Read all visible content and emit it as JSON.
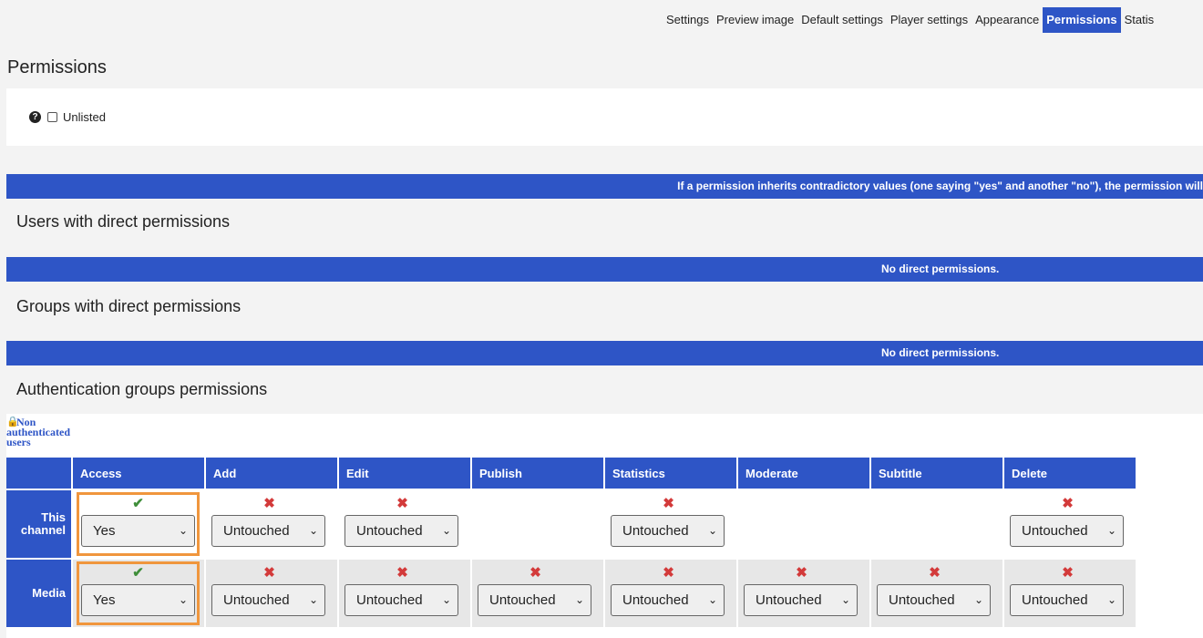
{
  "tabs": [
    {
      "label": "Settings",
      "active": false
    },
    {
      "label": "Preview image",
      "active": false
    },
    {
      "label": "Default settings",
      "active": false
    },
    {
      "label": "Player settings",
      "active": false
    },
    {
      "label": "Appearance",
      "active": false
    },
    {
      "label": "Permissions",
      "active": true
    },
    {
      "label": "Statis",
      "active": false
    }
  ],
  "page_title": "Permissions",
  "unlisted": {
    "label": "Unlisted",
    "checked": false,
    "help_icon": "question-circle-icon"
  },
  "info_bar": "If a permission inherits contradictory values (one saying \"yes\" and another \"no\"), the permission will",
  "users_section": {
    "title": "Users with direct permissions",
    "empty": "No direct permissions."
  },
  "groups_section": {
    "title": "Groups with direct permissions",
    "empty": "No direct permissions."
  },
  "auth_section": {
    "title": "Authentication groups permissions",
    "group_link_line1": "Non",
    "group_link_line2": "authenticated",
    "group_link_line3": "users",
    "lock_icon": "lock-icon"
  },
  "table": {
    "columns": [
      "Access",
      "Add",
      "Edit",
      "Publish",
      "Statistics",
      "Moderate",
      "Subtitle",
      "Delete"
    ],
    "rows": [
      {
        "label_line1": "This",
        "label_line2": "channel",
        "cells": [
          {
            "mark": "✔",
            "state": "yes",
            "value": "Yes",
            "highlight": true
          },
          {
            "mark": "✖",
            "state": "no",
            "value": "Untouched",
            "highlight": false
          },
          {
            "mark": "✖",
            "state": "no",
            "value": "Untouched",
            "highlight": false
          },
          null,
          {
            "mark": "✖",
            "state": "no",
            "value": "Untouched",
            "highlight": false
          },
          null,
          null,
          {
            "mark": "✖",
            "state": "no",
            "value": "Untouched",
            "highlight": false
          }
        ]
      },
      {
        "label_line1": "Media",
        "label_line2": "",
        "cells": [
          {
            "mark": "✔",
            "state": "yes",
            "value": "Yes",
            "highlight": true
          },
          {
            "mark": "✖",
            "state": "no",
            "value": "Untouched",
            "highlight": false
          },
          {
            "mark": "✖",
            "state": "no",
            "value": "Untouched",
            "highlight": false
          },
          {
            "mark": "✖",
            "state": "no",
            "value": "Untouched",
            "highlight": false
          },
          {
            "mark": "✖",
            "state": "no",
            "value": "Untouched",
            "highlight": false
          },
          {
            "mark": "✖",
            "state": "no",
            "value": "Untouched",
            "highlight": false
          },
          {
            "mark": "✖",
            "state": "no",
            "value": "Untouched",
            "highlight": false
          },
          {
            "mark": "✖",
            "state": "no",
            "value": "Untouched",
            "highlight": false
          }
        ]
      }
    ]
  },
  "colors": {
    "accent": "#2e55c6",
    "yes": "#3f8e3a",
    "no": "#d33a3a",
    "highlight": "#f0963d"
  }
}
